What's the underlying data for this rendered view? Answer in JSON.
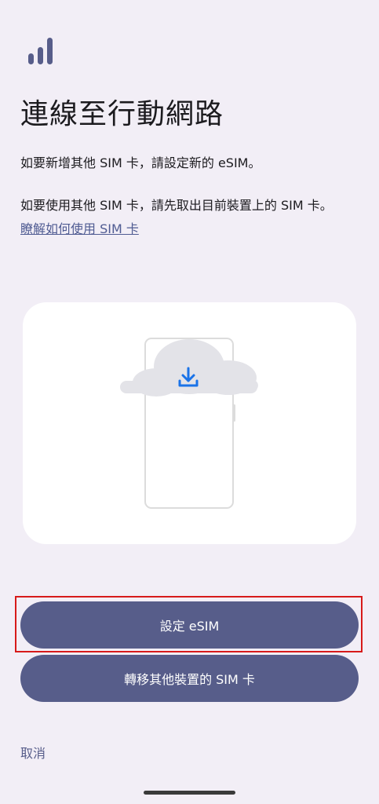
{
  "header": {
    "icon": "signal-strength-icon",
    "title": "連線至行動網路"
  },
  "body": {
    "paragraph_1": "如要新增其他 SIM 卡，請設定新的 eSIM。",
    "paragraph_2": "如要使用其他 SIM 卡，請先取出目前裝置上的 SIM 卡。",
    "learn_link": "瞭解如何使用 SIM 卡"
  },
  "illustration": {
    "icon": "phone-cloud-download-icon"
  },
  "actions": {
    "primary_label": "設定 eSIM",
    "secondary_label": "轉移其他裝置的 SIM 卡",
    "cancel_label": "取消"
  },
  "colors": {
    "background": "#f2eef6",
    "button": "#575d8a",
    "accent_link": "#4f5b92",
    "download_icon": "#1a73e8",
    "highlight": "#d71a1a"
  }
}
